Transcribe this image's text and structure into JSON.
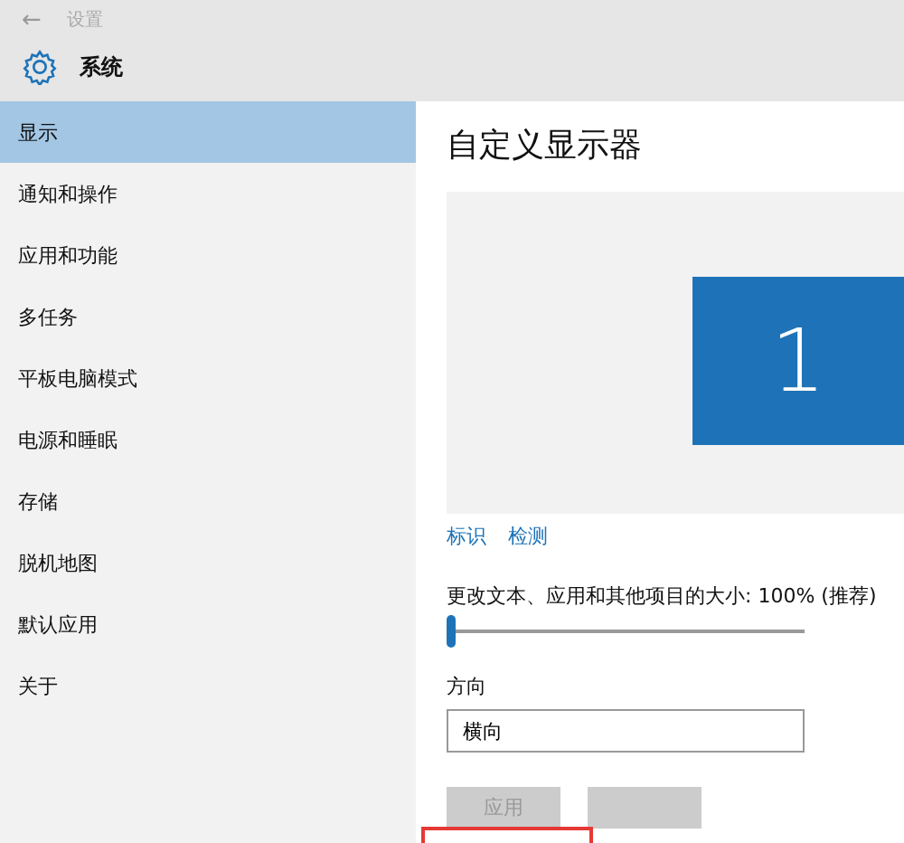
{
  "header": {
    "back": "←",
    "title": "设置",
    "section": "系统"
  },
  "sidebar": {
    "items": [
      {
        "label": "显示",
        "selected": true
      },
      {
        "label": "通知和操作",
        "selected": false
      },
      {
        "label": "应用和功能",
        "selected": false
      },
      {
        "label": "多任务",
        "selected": false
      },
      {
        "label": "平板电脑模式",
        "selected": false
      },
      {
        "label": "电源和睡眠",
        "selected": false
      },
      {
        "label": "存储",
        "selected": false
      },
      {
        "label": "脱机地图",
        "selected": false
      },
      {
        "label": "默认应用",
        "selected": false
      },
      {
        "label": "关于",
        "selected": false
      }
    ]
  },
  "main": {
    "title": "自定义显示器",
    "monitor": "1",
    "links": [
      "标识",
      "检测"
    ],
    "scale": {
      "label": "更改文本、应用和其他项目的大小: 100% (推荐)",
      "level": 0
    },
    "orientation": {
      "label": "方向",
      "value": "横向"
    },
    "buttons": [
      {
        "label": "应用",
        "disabled": true
      },
      {
        "disabled": true
      }
    ]
  }
}
